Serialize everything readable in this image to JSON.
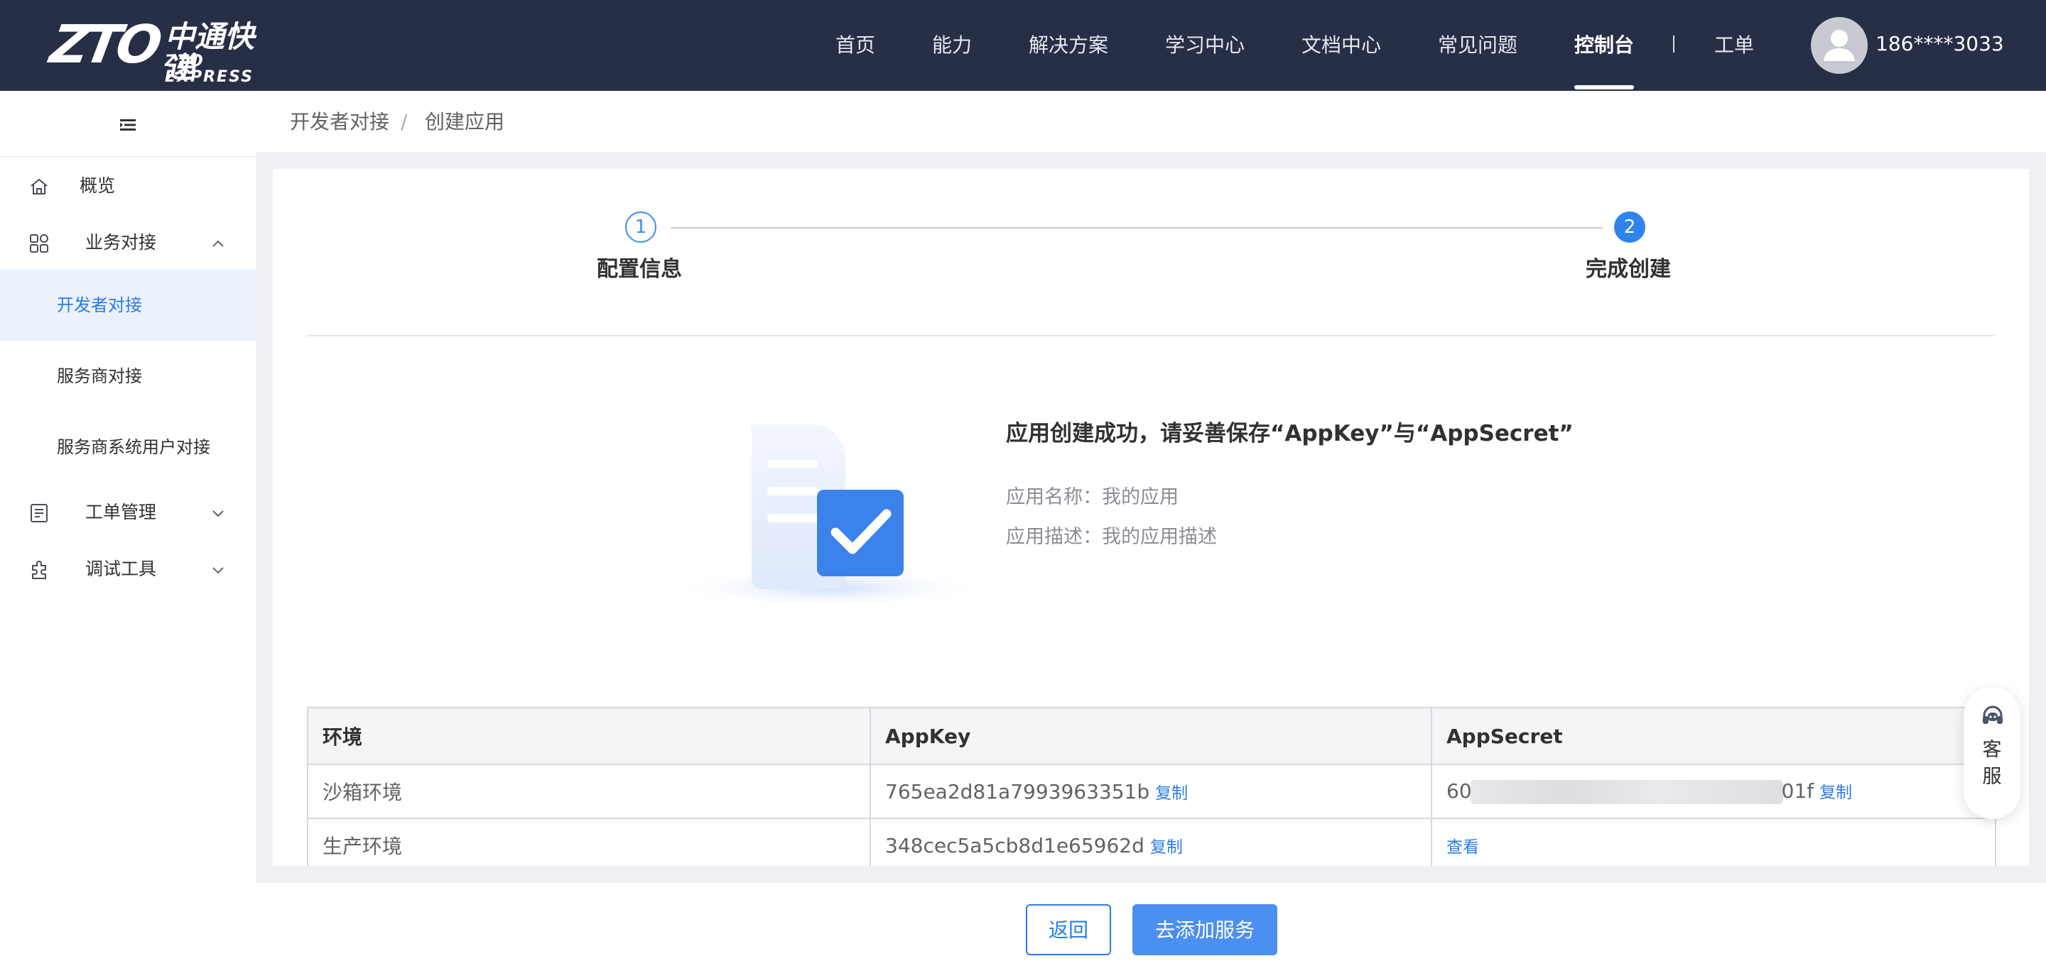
{
  "brand": {
    "logo_mark": "ZTO",
    "logo_cn": "中通快递",
    "logo_en": "ZTO EXPRESS"
  },
  "nav": {
    "items": [
      {
        "label": "首页"
      },
      {
        "label": "能力"
      },
      {
        "label": "解决方案"
      },
      {
        "label": "学习中心"
      },
      {
        "label": "文档中心"
      },
      {
        "label": "常见问题"
      },
      {
        "label": "控制台",
        "active": true
      },
      {
        "label": "工单"
      }
    ],
    "user_phone": "186****3033"
  },
  "sidebar": {
    "items": [
      {
        "label": "概览",
        "icon": "home-icon"
      },
      {
        "label": "业务对接",
        "icon": "apps-icon",
        "expanded": true,
        "children": [
          {
            "label": "开发者对接",
            "active": true
          },
          {
            "label": "服务商对接"
          },
          {
            "label": "服务商系统用户对接"
          }
        ]
      },
      {
        "label": "工单管理",
        "icon": "ticket-icon"
      },
      {
        "label": "调试工具",
        "icon": "puzzle-icon"
      }
    ]
  },
  "breadcrumb": {
    "parent": "开发者对接",
    "separator": "/",
    "current": "创建应用"
  },
  "steps": [
    {
      "number": "1",
      "title": "配置信息"
    },
    {
      "number": "2",
      "title": "完成创建",
      "active": true
    }
  ],
  "result": {
    "title": "应用创建成功，请妥善保存“AppKey”与“AppSecret”",
    "name_label": "应用名称：",
    "name_value": "我的应用",
    "desc_label": "应用描述：",
    "desc_value": "我的应用描述"
  },
  "table": {
    "headers": [
      "环境",
      "AppKey",
      "AppSecret"
    ],
    "rows": [
      {
        "env": "沙箱环境",
        "appkey": "765ea2d81a7993963351b",
        "copy": "复制",
        "secret_prefix": "60",
        "secret_suffix": "01f",
        "secret_copy": "复制"
      },
      {
        "env": "生产环境",
        "appkey": "348cec5a5cb8d1e65962d",
        "copy": "复制",
        "secret_view": "查看"
      }
    ]
  },
  "float_service": {
    "line1": "客",
    "line2": "服"
  },
  "actions": {
    "back": "返回",
    "add_service": "去添加服务"
  },
  "colors": {
    "topbar": "#272f47",
    "accent": "#2c7be5",
    "active_bg": "#ebf2fd"
  }
}
